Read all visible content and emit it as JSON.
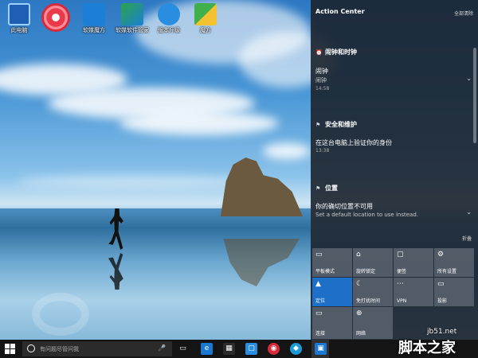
{
  "desktop": {
    "icons": [
      {
        "name": "this-pc-icon",
        "label": "此电脑",
        "color": "#1f5fb3"
      },
      {
        "name": "red-circle-icon",
        "label": "",
        "color": "#d62a3a"
      },
      {
        "name": "windows-helper-icon",
        "label": "软媒魔方",
        "color": "#1b7fd6"
      },
      {
        "name": "software-manager-icon",
        "label": "软媒软件管家",
        "color": "#2ba34a"
      },
      {
        "name": "win10-upgrade-icon",
        "label": "版本升级",
        "color": "#2a8ee0"
      },
      {
        "name": "app-icon",
        "label": "魔方",
        "color": "#3fb04b"
      }
    ]
  },
  "action_center": {
    "title": "Action Center",
    "clear_all": "全部清除",
    "groups": [
      {
        "header": "闹钟和时钟",
        "title": "闹钟",
        "subtitle": "闹钟",
        "time": "14:58",
        "has_chevron": true
      },
      {
        "header": "安全和维护",
        "title": "在这台电脑上验证你的身份",
        "subtitle": "",
        "time": "13:38",
        "has_chevron": false
      },
      {
        "header": "位置",
        "title": "你的确切位置不可用",
        "subtitle": "Set a default location to use instead.",
        "time": "",
        "has_chevron": true
      }
    ],
    "collapse_label": "折叠",
    "tiles": [
      {
        "label": "平板模式",
        "icon": "▭",
        "active": false
      },
      {
        "label": "旋转锁定",
        "icon": "⌂",
        "active": false
      },
      {
        "label": "便签",
        "icon": "▢",
        "active": false
      },
      {
        "label": "所有设置",
        "icon": "⚙",
        "active": false
      },
      {
        "label": "定位",
        "icon": "▲",
        "active": true
      },
      {
        "label": "免打扰时间",
        "icon": "☾",
        "active": false
      },
      {
        "label": "VPN",
        "icon": "⋯",
        "active": false
      },
      {
        "label": "投影",
        "icon": "▭",
        "active": false
      },
      {
        "label": "连接",
        "icon": "▭",
        "active": false
      },
      {
        "label": "网络",
        "icon": "⊕",
        "active": false
      }
    ]
  },
  "taskbar": {
    "search_placeholder": "有问题尽管问我",
    "mic_icon": "🎤",
    "task_view_icon": "▭",
    "apps": [
      {
        "name": "edge-icon",
        "glyph": "e",
        "color": "#1b78d0"
      },
      {
        "name": "store-icon",
        "glyph": "▦",
        "color": "#2b2b2b"
      },
      {
        "name": "app-blue-icon",
        "glyph": "▢",
        "color": "#2a8ee0"
      },
      {
        "name": "app-red-icon",
        "glyph": "◉",
        "color": "#d62a3a"
      },
      {
        "name": "app-cyan-icon",
        "glyph": "◆",
        "color": "#1b9ad6"
      },
      {
        "name": "action-center-app-icon",
        "glyph": "▣",
        "color": "#1b78d0"
      }
    ]
  },
  "watermark": {
    "url": "jb51.net",
    "text": "脚本之家"
  }
}
